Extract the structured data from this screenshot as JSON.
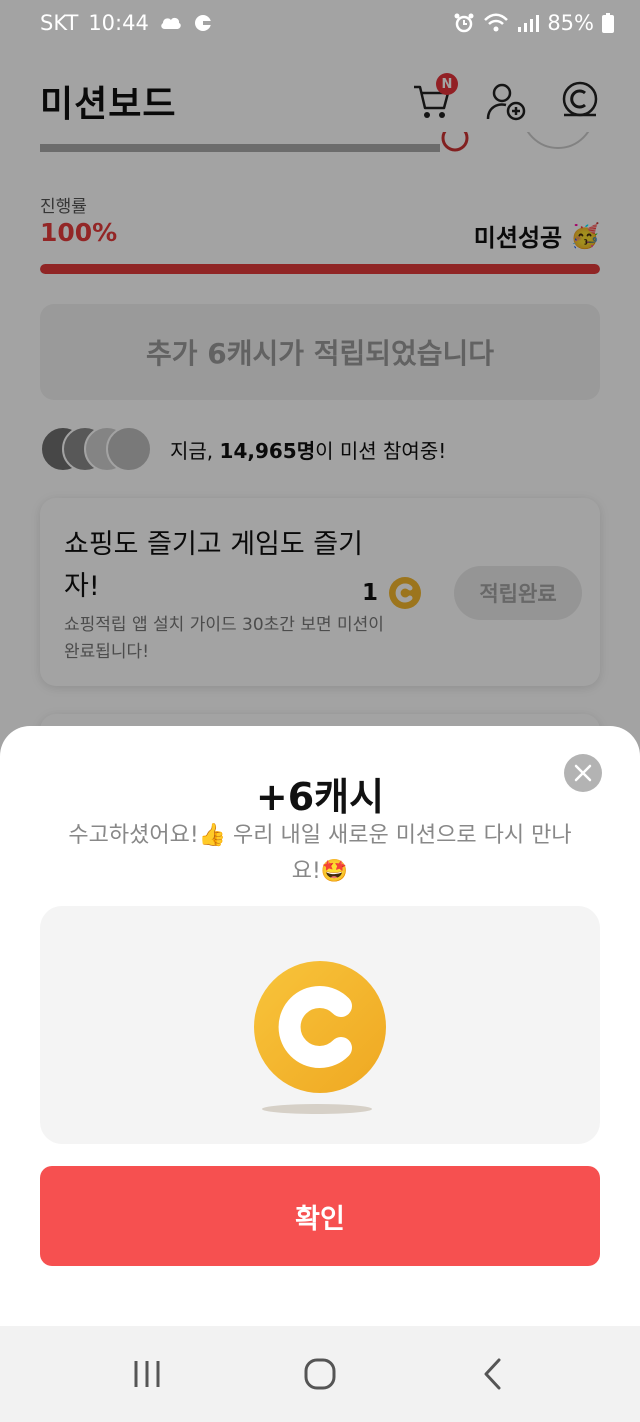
{
  "status_bar": {
    "carrier": "SKT",
    "time": "10:44",
    "battery": "85%"
  },
  "header": {
    "title": "미션보드",
    "cart_badge": "N"
  },
  "progress": {
    "label": "진행률",
    "value": "100%",
    "fraction": 1.0,
    "success_text": "미션성공",
    "success_emoji": "🥳"
  },
  "extra_cash_message": "추가 6캐시가 적립되었습니다",
  "participants": {
    "prefix": "지금,",
    "count": "14,965명",
    "suffix": "이 미션 참여중!"
  },
  "mission_card": {
    "title": "쇼핑도 즐기고 게임도 즐기자!",
    "description": "쇼핑적립 앱 설치 가이드 30초간 보면 미션이 완료됩니다!",
    "reward": "1",
    "button_label": "적립완료"
  },
  "dialog": {
    "title": "+6캐시",
    "message": "수고하셨어요!👍 우리 내일 새로운 미션으로 다시 만나요!🤩",
    "confirm_label": "확인"
  },
  "colors": {
    "accent_red": "#f65050",
    "progress_red": "#e23b3b",
    "coin_yellow": "#f5b82e"
  }
}
